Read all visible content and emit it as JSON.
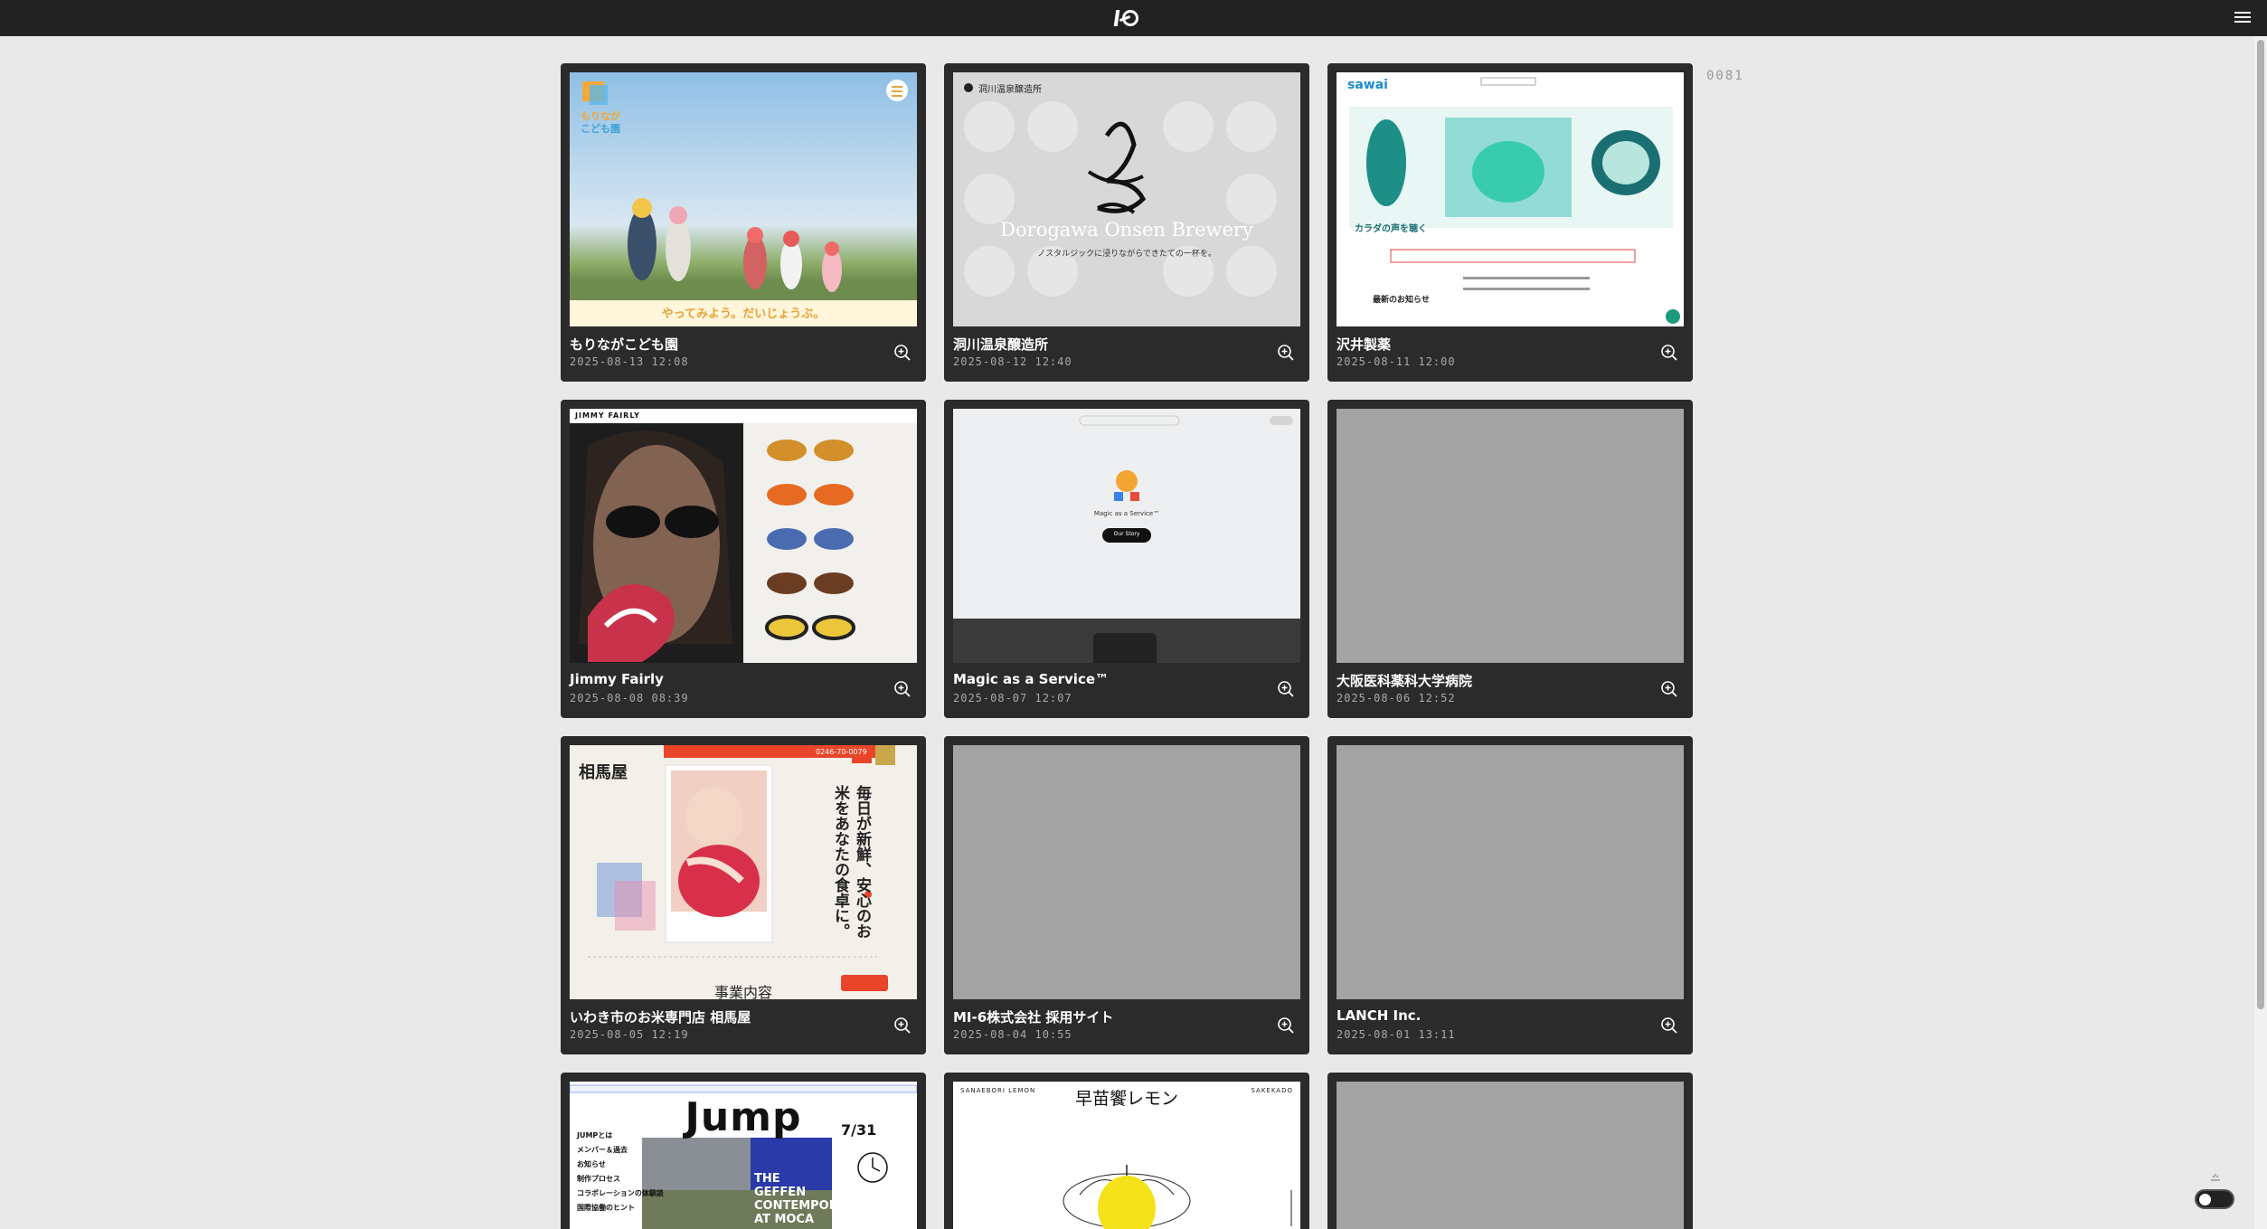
{
  "app": {
    "logo_text": ""
  },
  "counter": "0081",
  "colors": {
    "topbar": "#222222",
    "background": "#e9e9e9",
    "card": "#2b2b2b",
    "placeholder": "#a3a3a3"
  },
  "cards": [
    {
      "title": "もりながこども園",
      "date": "2025-08-13 12:08",
      "thumb": {
        "brand_line1": "もりなが",
        "brand_line2": "こども園",
        "tagline": "やってみよう。だいじょうぶ。"
      }
    },
    {
      "title": "洞川温泉醸造所",
      "date": "2025-08-12 12:40",
      "thumb": {
        "header": "洞川温泉醸造所",
        "headline": "Dorogawa Onsen Brewery",
        "sub": "ノスタルジックに浸りながらできたての一杯を。"
      }
    },
    {
      "title": "沢井製薬",
      "date": "2025-08-11 12:00",
      "thumb": {
        "brand": "sawai",
        "caption": "カラダの声を聴く",
        "news": "最新のお知らせ"
      }
    },
    {
      "title": "Jimmy Fairly",
      "date": "2025-08-08 08:39",
      "thumb": {
        "brand": "JIMMY FAIRLY"
      }
    },
    {
      "title": "Magic as a Service™",
      "date": "2025-08-07 12:07",
      "thumb": {
        "label": "Magic as a Service™",
        "cta": "Our Story"
      }
    },
    {
      "title": "大阪医科薬科大学病院",
      "date": "2025-08-06 12:52",
      "thumb": {}
    },
    {
      "title": "いわき市のお米専門店 相馬屋",
      "date": "2025-08-05 12:19",
      "thumb": {
        "brand": "相馬屋",
        "vertical": "毎日が新鮮、安心のお米をあなたの食卓に。",
        "section": "事業内容",
        "phone": "0246-70-0079"
      }
    },
    {
      "title": "MI-6株式会社 採用サイト",
      "date": "2025-08-04 10:55",
      "thumb": {}
    },
    {
      "title": "LANCH Inc.",
      "date": "2025-08-01 13:11",
      "thumb": {}
    },
    {
      "title": "",
      "date": "",
      "thumb": {
        "brand": "Jump",
        "menu": [
          "JUMPとは",
          "メンバー＆過去",
          "お知らせ",
          "制作プロセス",
          "コラボレーションの体験談",
          "国際協働のヒント"
        ],
        "sign": "THE GEFFEN CONTEMPORARY AT MOCA",
        "date_big": "7/31"
      }
    },
    {
      "title": "",
      "date": "",
      "thumb": {
        "top_left": "SANAEBORI LEMON",
        "top_right": "SAKEKADO",
        "headline": "早苗饗レモン"
      }
    },
    {
      "title": "",
      "date": "",
      "thumb": {}
    }
  ]
}
